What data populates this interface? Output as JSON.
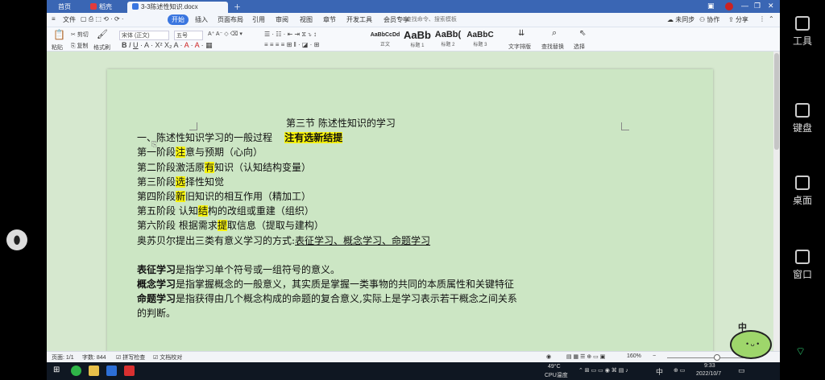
{
  "right_panel": {
    "tools": "工具",
    "keyboard": "键盘",
    "desktop": "桌面",
    "window": "窗口"
  },
  "tabs": {
    "home": "首页",
    "app": "稻壳",
    "doc": "3-3陈述性知识.docx"
  },
  "menu": {
    "file": "文件",
    "start": "开始",
    "insert": "插入",
    "layout": "页面布局",
    "reference": "引用",
    "review": "审阅",
    "view": "视图",
    "chapter": "章节",
    "dev": "开发工具",
    "member": "会员专享",
    "search": "查找命令、搜索模板",
    "unsync": "未同步",
    "collab": "协作",
    "share": "分享"
  },
  "ribbon": {
    "paste": "粘贴",
    "cut": "剪切",
    "copy": "复制",
    "format_painter": "格式刷",
    "font_name": "宋体 (正文)",
    "font_size": "五号",
    "styles": [
      {
        "sample": "AaBbCcDd",
        "name": "正文"
      },
      {
        "sample": "AaBb",
        "name": "标题 1"
      },
      {
        "sample": "AaBb(",
        "name": "标题 2"
      },
      {
        "sample": "AaBbC",
        "name": "标题 3"
      }
    ],
    "text_arrange": "文字排版",
    "find_replace": "查找替换",
    "select": "选择"
  },
  "document": {
    "title": "第三节  陈述性知识的学习",
    "line1_a": "一、陈述性知识学习的一般过程",
    "line1_b": "注有选新结提",
    "s1_a": "第一阶段",
    "s1_h": "注",
    "s1_b": "意与预期（心向）",
    "s2_a": "第二阶段激活原",
    "s2_h": "有",
    "s2_b": "知识（认知结构变量）",
    "s3_a": "第三阶段",
    "s3_h": "选",
    "s3_b": "择性知觉",
    "s4_a": "第四阶段",
    "s4_h": "新",
    "s4_b": "旧知识的相互作用（精加工）",
    "s5_a": "第五阶段  认知",
    "s5_h": "结",
    "s5_b": "构的改组或重建（组织）",
    "s6_a": "第六阶段  根据需求",
    "s6_h": "提",
    "s6_b": "取信息（提取与建构）",
    "ausubel_a": "奥苏贝尔提出三类有意义学习的方式:",
    "ausubel_b": "表征学习、概念学习、命题学习",
    "rep_a": "表征学习",
    "rep_b": "是指学习单个符号或一组符号的意义。",
    "con_a": "概念学习",
    "con_b": "是指掌握概念的一般意义，其实质是掌握一类事物的共同的本质属性和关键特征",
    "pro_a": "命题学习",
    "pro_b": "是指获得由几个概念构成的命题的复合意义,实际上是学习表示若干概念之间关系",
    "pro_c": "的判断。"
  },
  "status": {
    "page": "页面: 1/1",
    "words": "字数: 844",
    "spell": "拼写检查",
    "proof": "文档校对",
    "zoom": "160%"
  },
  "taskbar": {
    "temp": "49°C",
    "cpu": "CPU温度",
    "ime": "中",
    "time": "9:33",
    "date": "2022/10/7"
  }
}
